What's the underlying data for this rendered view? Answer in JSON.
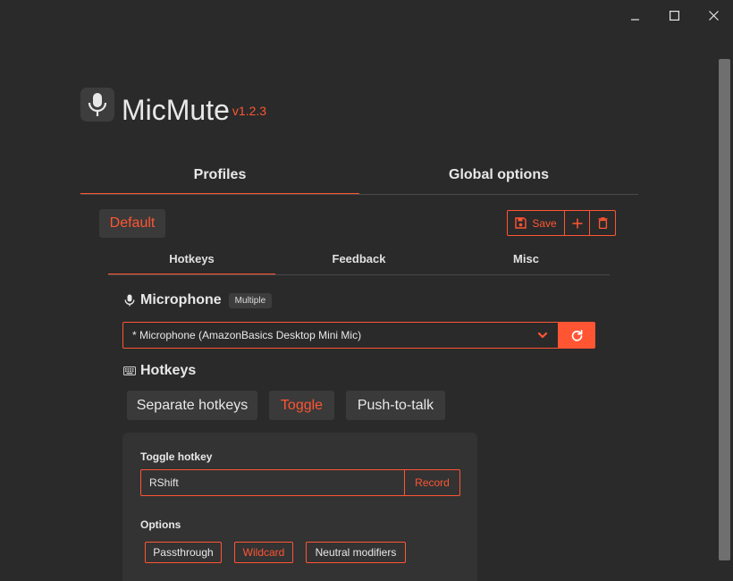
{
  "window": {
    "controls": [
      "minimize-icon",
      "maximize-icon",
      "close-icon"
    ]
  },
  "app": {
    "name": "MicMute",
    "version": "v1.2.3",
    "icon": "microphone-icon"
  },
  "main_tabs": [
    {
      "label": "Profiles",
      "active": true
    },
    {
      "label": "Global options",
      "active": false
    }
  ],
  "profile": {
    "current": "Default",
    "save_label": "Save",
    "add_icon": "plus-icon",
    "delete_icon": "trash-icon"
  },
  "sub_tabs": [
    {
      "label": "Hotkeys",
      "active": true
    },
    {
      "label": "Feedback",
      "active": false
    },
    {
      "label": "Misc",
      "active": false
    }
  ],
  "microphone": {
    "title": "Microphone",
    "badge": "Multiple",
    "selected": "* Microphone (AmazonBasics Desktop Mini Mic)",
    "refresh_icon": "refresh-icon"
  },
  "hotkeys": {
    "title": "Hotkeys",
    "modes": [
      {
        "label": "Separate hotkeys",
        "active": false
      },
      {
        "label": "Toggle",
        "active": true
      },
      {
        "label": "Push-to-talk",
        "active": false
      }
    ],
    "toggle_label": "Toggle hotkey",
    "toggle_value": "RShift",
    "record_label": "Record",
    "options_label": "Options",
    "options": [
      {
        "label": "Passthrough",
        "active": false
      },
      {
        "label": "Wildcard",
        "active": true
      },
      {
        "label": "Neutral modifiers",
        "active": false
      }
    ]
  },
  "colors": {
    "accent": "#ff5533",
    "background": "#2a2a2a",
    "surface": "#333333",
    "button": "#3a3a3a"
  }
}
